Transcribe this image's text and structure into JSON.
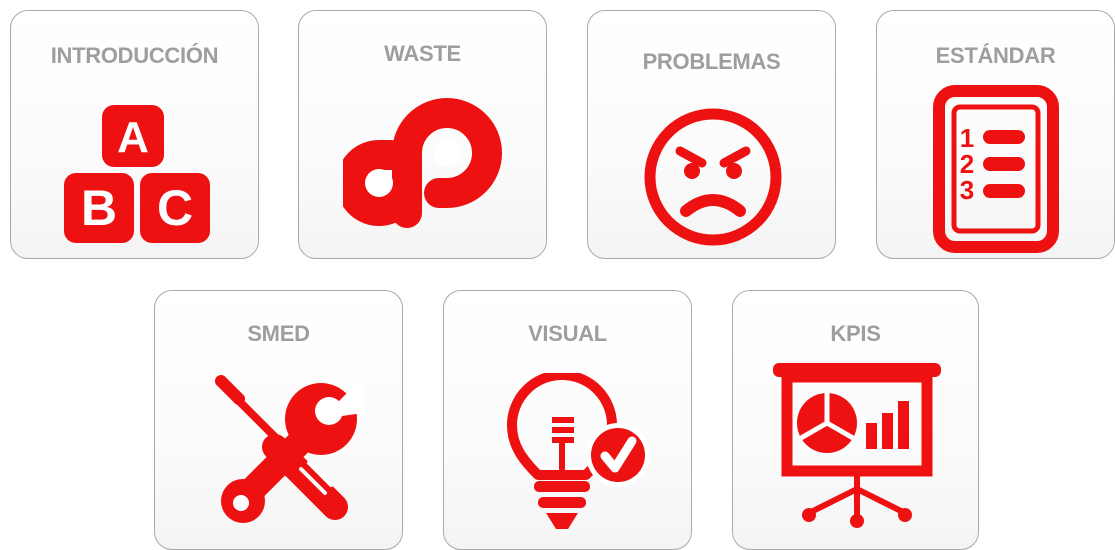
{
  "accent_color": "#ee1111",
  "label_color": "#9e9e9e",
  "tiles": [
    {
      "label": "INTRODUCCIÓN",
      "icon": "abc-blocks-icon"
    },
    {
      "label": "WASTE",
      "icon": "waste-loop-icon"
    },
    {
      "label": "PROBLEMAS",
      "icon": "angry-face-icon"
    },
    {
      "label": "ESTÁNDAR",
      "icon": "numbered-list-icon"
    },
    {
      "label": "SMED",
      "icon": "screwdriver-wrench-icon"
    },
    {
      "label": "VISUAL",
      "icon": "lightbulb-check-icon"
    },
    {
      "label": "KPIS",
      "icon": "presentation-chart-icon"
    }
  ],
  "icon_text": {
    "blocks": [
      "A",
      "B",
      "C"
    ],
    "list_numbers": [
      "1",
      "2",
      "3"
    ]
  }
}
